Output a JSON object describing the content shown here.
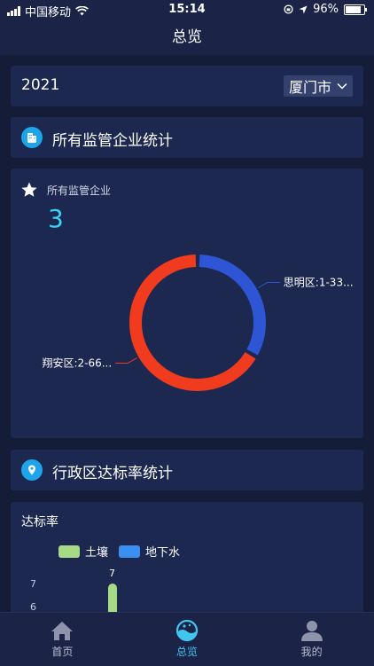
{
  "status": {
    "carrier": "中国移动",
    "time": "15:14",
    "battery": "96%",
    "battery_level": 0.96
  },
  "nav": {
    "title": "总览"
  },
  "filter": {
    "year": "2021",
    "city": "厦门市"
  },
  "sections": [
    {
      "title": "所有监管企业统计",
      "icon": "buildings-icon"
    },
    {
      "title": "行政区达标率统计",
      "icon": "map-pin-icon"
    }
  ],
  "enterprise": {
    "title": "所有监管企业",
    "total": "3",
    "chart_data": {
      "type": "pie",
      "variant": "donut",
      "slices": [
        {
          "label": "思明区:1-33...",
          "value": 1,
          "color": "#2e55d6"
        },
        {
          "label": "翔安区:2-66...",
          "value": 2,
          "color": "#f03b1e"
        }
      ]
    }
  },
  "rate_chart": {
    "title": "达标率",
    "chart_data": {
      "type": "bar",
      "series": [
        {
          "name": "土壤",
          "color": "#a6da86",
          "values": [
            7
          ]
        },
        {
          "name": "地下水",
          "color": "#3a8ff0",
          "values": []
        }
      ],
      "y_ticks": [
        "7",
        "6"
      ],
      "data_labels": [
        "7"
      ]
    }
  },
  "tabs": [
    {
      "label": "首页",
      "icon": "home-icon",
      "active": false
    },
    {
      "label": "总览",
      "icon": "overview-icon",
      "active": true
    },
    {
      "label": "我的",
      "icon": "user-icon",
      "active": false
    }
  ]
}
